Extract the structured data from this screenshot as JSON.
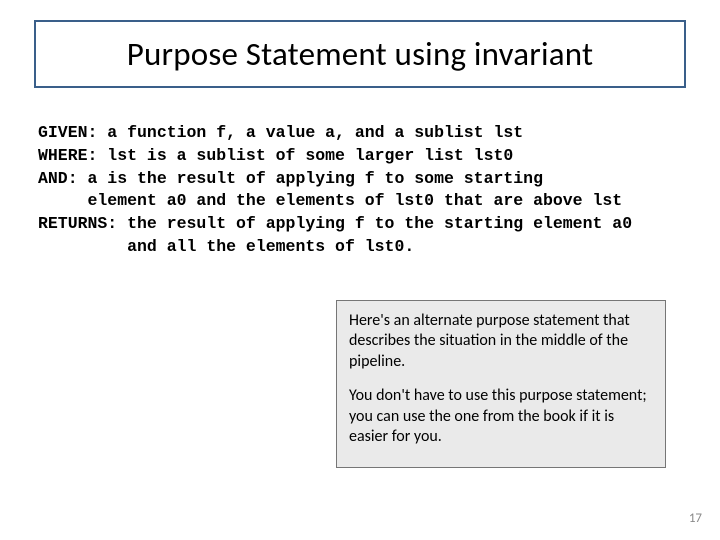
{
  "title": "Purpose Statement using invariant",
  "code": {
    "l1": "GIVEN: a function f, a value a, and a sublist lst",
    "l2": "WHERE: lst is a sublist of some larger list lst0",
    "l3": "AND: a is the result of applying f to some starting",
    "l4": "     element a0 and the elements of lst0 that are above lst",
    "l5": "RETURNS: the result of applying f to the starting element a0",
    "l6": "         and all the elements of lst0."
  },
  "note": {
    "p1": "Here's an alternate purpose statement that describes the situation in the middle of the pipeline.",
    "p2": "You don't have to use this purpose statement; you can use the one from the book if it is easier for you."
  },
  "page_number": "17"
}
